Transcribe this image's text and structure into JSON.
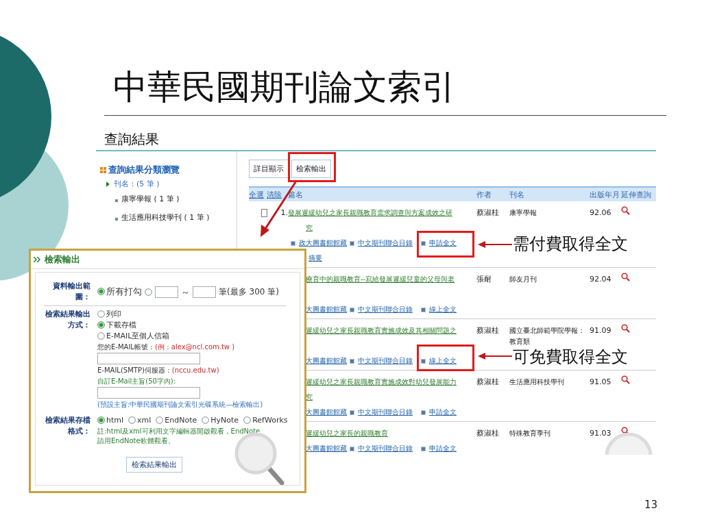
{
  "slide": {
    "title": "中華民國期刊論文索引",
    "heading": "查詢結果",
    "page_number": "13"
  },
  "sidebar": {
    "title": "查詢結果分類瀏覽",
    "group": "刊名：(5 筆 )",
    "items": [
      "康寧學報 ( 1 筆 )",
      "生活應用科技學刊 ( 1 筆 )"
    ]
  },
  "tabs": [
    "詳目顯示",
    "檢索輸出"
  ],
  "table": {
    "select_all": "全選",
    "clear": "清除",
    "columns": [
      "篇名",
      "作者",
      "刊名",
      "出版年月",
      "延伸查詢"
    ],
    "rows": [
      {
        "checked": false,
        "number": "1.",
        "title_lines": [
          "發展遲緩幼兒之家長親職教育需求調查與方案成效之研",
          "究"
        ],
        "author": "蔡淑桂",
        "journal": "康寧學報",
        "date": "92.06",
        "link_lines": [
          [
            {
              "text": "政大圖書館館藏",
              "bullet": true
            },
            {
              "text": "中文期刊聯合目錄",
              "bullet": true
            },
            {
              "text": "申請全文",
              "bullet": true
            }
          ],
          [
            {
              "text": "摘要",
              "bullet": false
            }
          ]
        ]
      },
      {
        "title_lines": [
          "療育中的親職教育--寫給發展遲緩兒童的父母與老"
        ],
        "author": "張耐",
        "journal": "師友月刊",
        "date": "92.04",
        "link_lines": [
          [
            {
              "text": "大圖書館館藏",
              "bullet": false
            },
            {
              "text": "中文期刊聯合目錄",
              "bullet": true
            },
            {
              "text": "線上全文",
              "bullet": true
            }
          ]
        ]
      },
      {
        "title_lines": [
          "遲緩幼兒之家長親職教育實施成效及其相關問題之"
        ],
        "author": "蔡淑桂",
        "journal": "國立臺北師範學院學報：教育類",
        "date": "91.09",
        "link_lines": [
          [
            {
              "text": "大圖書館館藏",
              "bullet": false
            },
            {
              "text": "中文期刊聯合目錄",
              "bullet": true
            },
            {
              "text": "線上全文",
              "bullet": true
            }
          ]
        ]
      },
      {
        "title_lines": [
          "遲緩幼兒之家長親職教育實施成效對幼兒發展能力",
          "究"
        ],
        "author": "蔡淑桂",
        "journal": "生活應用科技學刊",
        "date": "91.05",
        "link_lines": [
          [
            {
              "text": "大圖書館館藏",
              "bullet": false
            },
            {
              "text": "中文期刊聯合目錄",
              "bullet": true
            },
            {
              "text": "申請全文",
              "bullet": true
            }
          ]
        ]
      },
      {
        "title_lines": [
          "遲緩幼兒之家長的親職教育"
        ],
        "author": "蔡淑桂",
        "journal": "特殊教育季刊",
        "date": "91.03",
        "link_lines": [
          [
            {
              "text": "大圖書館館藏",
              "bullet": false
            },
            {
              "text": "中文期刊聯合目錄",
              "bullet": true
            },
            {
              "text": "申請全文",
              "bullet": true
            }
          ]
        ]
      }
    ]
  },
  "export_dialog": {
    "title": "檢索輸出",
    "range": {
      "label": "資料輸出範圍：",
      "all_option": {
        "label": "所有打勾",
        "selected": true
      },
      "range_option": {
        "selected": false
      },
      "separator": "～",
      "limit_note": "筆(最多 300 筆)"
    },
    "method": {
      "label": "檢索結果輸出方式：",
      "options": [
        {
          "label": "列印",
          "selected": false
        },
        {
          "label": "下載存檔",
          "selected": true
        },
        {
          "label": "E-MAIL至個人信箱",
          "selected": false
        }
      ],
      "email_label": "您的E-MAIL帳號：",
      "email_example": "(例：alex@ncl.com.tw )",
      "smtp_label": "E-MAIL(SMTP)伺服器：",
      "smtp_example": "(nccu.edu.tw)",
      "subject_label": "自訂E-Mail主旨(50字內):",
      "subject_default": "(預設主旨:中華民國期刊論文索引光碟系統—檢索輸出)"
    },
    "format": {
      "label": "檢索結果存檔格式：",
      "options": [
        {
          "label": "html",
          "selected": true
        },
        {
          "label": "xml",
          "selected": false
        },
        {
          "label": "EndNote",
          "selected": false
        },
        {
          "label": "HyNote",
          "selected": false
        },
        {
          "label": "RefWorks",
          "selected": false
        }
      ],
      "note": "註:html及xml可利用文字編輯器開啟觀看，EndNote請用EndNote軟體觀看。"
    },
    "submit": "檢索結果輸出"
  },
  "annotations": [
    "需付費取得全文",
    "可免費取得全文"
  ]
}
